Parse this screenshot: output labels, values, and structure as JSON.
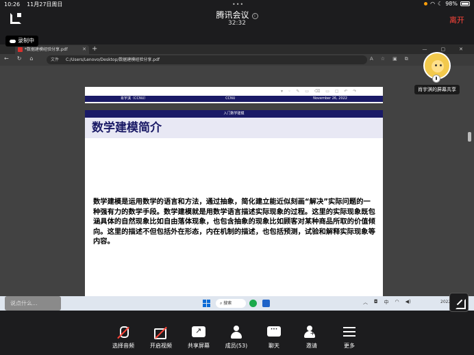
{
  "status_bar": {
    "time": "10:26",
    "date": "11月27日周日",
    "battery": "98%"
  },
  "meeting": {
    "title": "腾讯会议",
    "timer": "32:32",
    "leave_label": "离开",
    "recording_label": "录制中"
  },
  "browser": {
    "tab_title": "*数据建模经验分享.pdf",
    "url_label": "文件",
    "url": "C:/Users/Lenovo/Desktop/数据建模经验分享.pdf"
  },
  "slide_prev_footer": {
    "author": "肖宇淇（CCNU）",
    "org": "CCNU",
    "date": "November 26, 2022"
  },
  "slide": {
    "section": "入门数学建模",
    "title": "数学建模简介",
    "paragraph": "数学建模是运用数学的语言和方法，通过抽象，简化建立能近似刻画“解决”实际问题的一种强有力的数学手段。数学建模就是用数学语言描述实际现象的过程。这里的实际现象既包涵具体的自然现象比如自由落体现象，也包含抽象的现象比如顾客对某种商品所取的价值倾向。这里的描述不但包括外在形态，内在机制的描述，也包括预测，试验和解释实际现象等内容。"
  },
  "participant": {
    "name": "肖宇淇的屏幕共享"
  },
  "taskbar": {
    "chat_placeholder": "说点什么...",
    "search_label": "搜索",
    "clock": "2022"
  },
  "toolbar": [
    {
      "label": "选择音频",
      "icon": "mic-off-icon"
    },
    {
      "label": "开启视频",
      "icon": "camera-off-icon"
    },
    {
      "label": "共享屏幕",
      "icon": "share-screen-icon"
    },
    {
      "label": "成员(53)",
      "icon": "members-icon"
    },
    {
      "label": "聊天",
      "icon": "chat-icon"
    },
    {
      "label": "邀请",
      "icon": "invite-icon"
    },
    {
      "label": "更多",
      "icon": "more-icon"
    }
  ],
  "colors": {
    "slide_accent": "#1a1a66",
    "leave": "#ff453a",
    "recording_dot": "#ff9f0a"
  }
}
